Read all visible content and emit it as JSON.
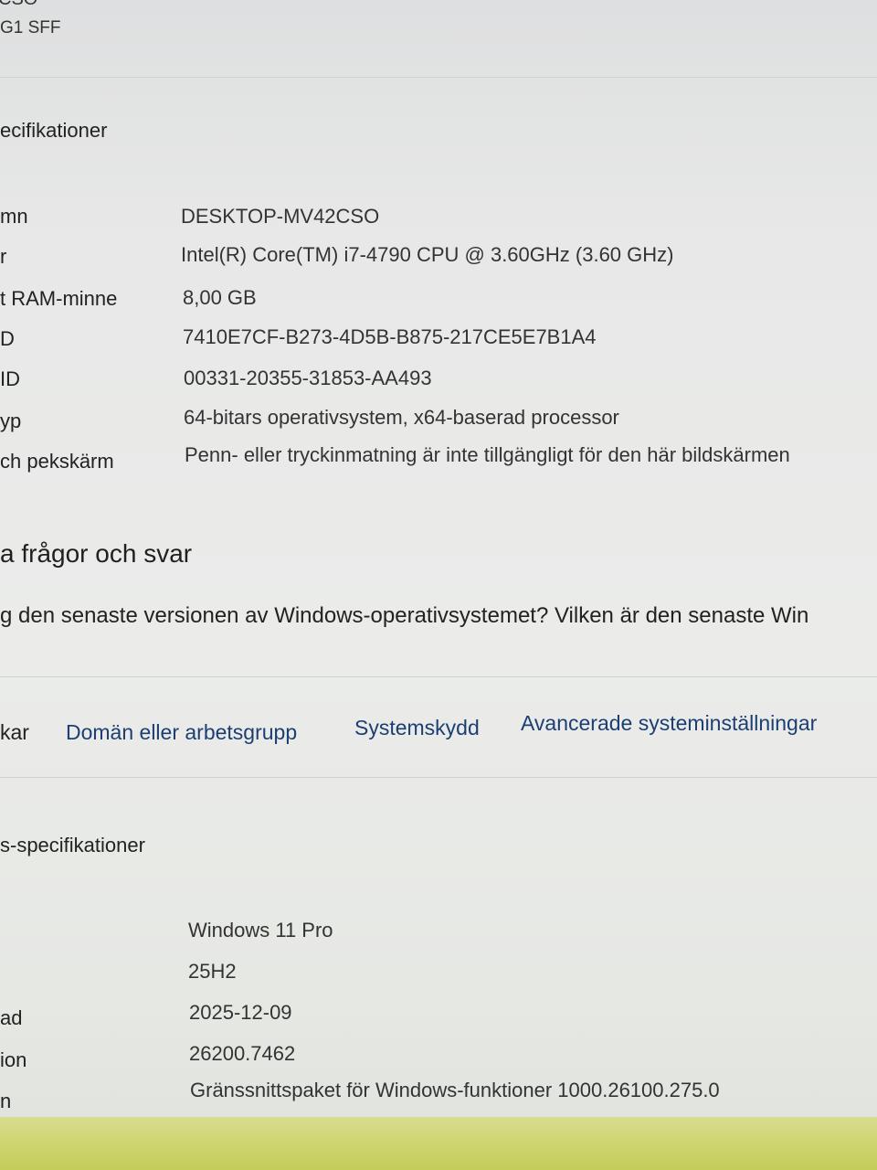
{
  "header": {
    "name_fragment": "CSO",
    "model_fragment": "G1 SFF"
  },
  "device_specs": {
    "title": "ecifikationer",
    "rows": [
      {
        "label": "mn",
        "value": "DESKTOP-MV42CSO"
      },
      {
        "label": "r",
        "value": "Intel(R) Core(TM) i7-4790 CPU @ 3.60GHz (3.60 GHz)"
      },
      {
        "label": "t RAM-minne",
        "value": "8,00 GB"
      },
      {
        "label": "D",
        "value": "7410E7CF-B273-4D5B-B875-217CE5E7B1A4"
      },
      {
        "label": "ID",
        "value": "00331-20355-31853-AA493"
      },
      {
        "label": "yp",
        "value": "64-bitars operativsystem, x64-baserad processor"
      },
      {
        "label": "ch pekskärm",
        "value": "Penn- eller tryckinmatning är inte tillgängligt för den här bildskärmen"
      }
    ]
  },
  "faq": {
    "title": "a frågor och svar",
    "question": "g den senaste versionen av Windows-operativsystemet? Vilken är den senaste Win"
  },
  "links": {
    "partial": "kar",
    "domain": "Domän eller arbetsgrupp",
    "protection": "Systemskydd",
    "advanced": "Avancerade systeminställningar"
  },
  "windows_specs": {
    "title": "s-specifikationer",
    "rows": [
      {
        "label": "",
        "value": "Windows 11 Pro"
      },
      {
        "label": "",
        "value": "25H2"
      },
      {
        "label": "ad",
        "value": "2025-12-09"
      },
      {
        "label": "ion",
        "value": "26200.7462"
      },
      {
        "label": "n",
        "value": "Gränssnittspaket för Windows-funktioner 1000.26100.275.0"
      }
    ]
  },
  "colors": {
    "background": "#e9ebe9",
    "text": "#2a2a2a",
    "link": "#1b3f73",
    "taskbar": "#cbd36a"
  }
}
